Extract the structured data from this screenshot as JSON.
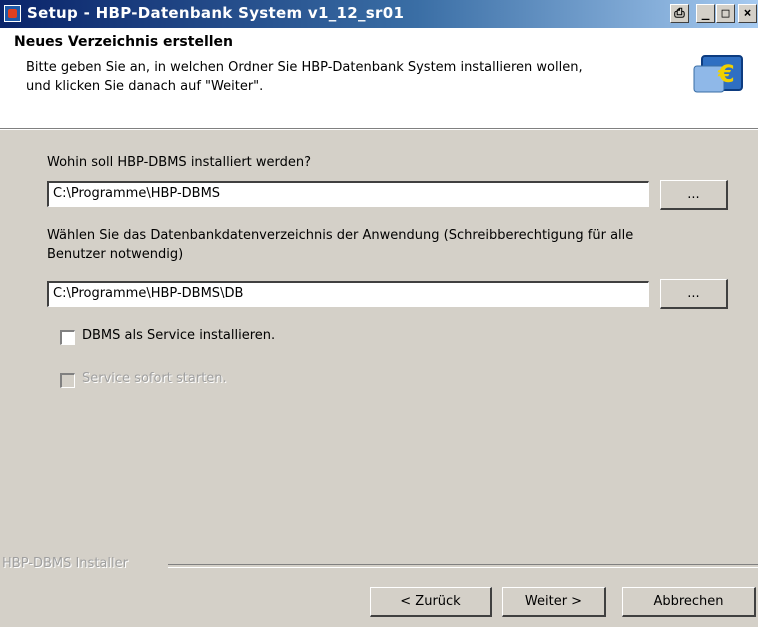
{
  "window": {
    "title": "Setup - HBP-Datenbank System v1_12_sr01",
    "controls": [
      "printer-icon",
      "minimize-icon",
      "maximize-icon",
      "close-icon"
    ]
  },
  "header": {
    "title": "Neues Verzeichnis erstellen",
    "description_line1": "Bitte geben Sie an, in welchen Ordner Sie HBP-Datenbank System installieren wollen,",
    "description_line2": "und klicken Sie danach auf \"Weiter\"."
  },
  "install_dir": {
    "label": "Wohin soll HBP-DBMS installiert werden?",
    "value": "C:\\Programme\\HBP-DBMS",
    "browse_label": "..."
  },
  "data_dir": {
    "label_line1": "Wählen Sie das Datenbankdatenverzeichnis der Anwendung (Schreibberechtigung für alle",
    "label_line2": "Benutzer notwendig)",
    "value": "C:\\Programme\\HBP-DBMS\\DB",
    "browse_label": "..."
  },
  "options": {
    "service_install": {
      "label": "DBMS als Service installieren.",
      "checked": false,
      "enabled": true
    },
    "service_start": {
      "label": "Service sofort starten.",
      "checked": false,
      "enabled": false
    }
  },
  "footer": {
    "installer_label": "HBP-DBMS Installer",
    "back_label": "< Zurück",
    "next_label": "Weiter >",
    "cancel_label": "Abbrechen"
  },
  "colors": {
    "titlebar_start": "#0a246a",
    "titlebar_end": "#a6caf0",
    "dialog_face": "#d4d0c8"
  }
}
